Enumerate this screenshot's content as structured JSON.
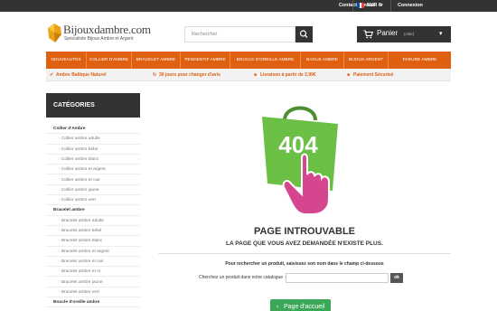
{
  "topbar": {
    "contact": "Contactez-nous",
    "currency": "EUR €",
    "login": "Connexion",
    "flag_colors": [
      "#0055a4",
      "#ffffff",
      "#ef4135"
    ]
  },
  "logo": {
    "name": "Bijouxdambre.com",
    "tagline": "Spécialiste Bijoux Ambre et Argent"
  },
  "search": {
    "placeholder": "Rechercher",
    "icon": "search-icon"
  },
  "cart": {
    "label": "Panier",
    "empty": "(vide)",
    "icon": "cart-icon"
  },
  "nav": {
    "items": [
      "NOUVEAUTÉS",
      "COLLIER D'AMBRE",
      "BRACELET AMBRE",
      "PENDENTIF AMBRE",
      "BOUCLE D'OREILLE AMBRE",
      "BAGUE AMBRE",
      "BIJOUX ARGENT",
      "PARURE AMBRE"
    ],
    "color": "#e06012"
  },
  "info": {
    "items": [
      "Ambre Baltique Naturel",
      "30 jours pour changer d'avis",
      "Livraison à partir de 2,99€",
      "Paiement Sécurisé"
    ]
  },
  "sidebar": {
    "heading": "CATÉGORIES",
    "rows": [
      {
        "type": "g",
        "label": "Collier d'Ambre"
      },
      {
        "type": "s",
        "label": "Collier ambre adulte"
      },
      {
        "type": "s",
        "label": "Collier ambre bébé"
      },
      {
        "type": "s",
        "label": "Collier ambre blanc"
      },
      {
        "type": "s",
        "label": "Collier ambre et argent"
      },
      {
        "type": "s",
        "label": "Collier ambre et cuir"
      },
      {
        "type": "s",
        "label": "Collier ambre jaune"
      },
      {
        "type": "s",
        "label": "Collier ambre vert"
      },
      {
        "type": "g",
        "label": "Bracelet ambre"
      },
      {
        "type": "s",
        "label": "Bracelet ambre adulte"
      },
      {
        "type": "s",
        "label": "Bracelet ambre bébé"
      },
      {
        "type": "s",
        "label": "Bracelet ambre blanc"
      },
      {
        "type": "s",
        "label": "Bracelet ambre et argent"
      },
      {
        "type": "s",
        "label": "Bracelet ambre et cuir"
      },
      {
        "type": "s",
        "label": "Bracelet ambre et or"
      },
      {
        "type": "s",
        "label": "Bracelet ambre jaune"
      },
      {
        "type": "s",
        "label": "Bracelet ambre vert"
      },
      {
        "type": "g",
        "label": "Boucle d'oreille ambre"
      }
    ]
  },
  "main": {
    "bag_text": "404",
    "title": "PAGE INTROUVABLE",
    "subtitle": "LA PAGE QUE VOUS AVEZ DEMANDÉE N'EXISTE PLUS.",
    "hint": "Pour rechercher un produit, saisissez son nom dans le champ ci-dessous",
    "search_label": "Cherchez un produit dans notre catalogue :",
    "search_value": "",
    "ok": "ok",
    "home_button": "Page d'accueil",
    "bag_color": "#6bbf44",
    "hand_color": "#d6468f"
  }
}
